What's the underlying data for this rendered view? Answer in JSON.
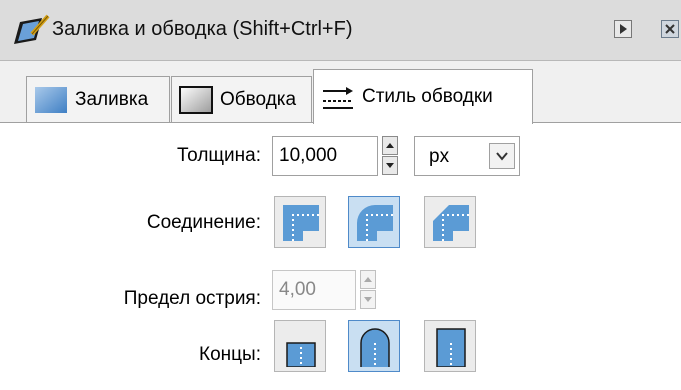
{
  "window": {
    "title": "Заливка и обводка (Shift+Ctrl+F)"
  },
  "tabs": [
    {
      "label": "Заливка",
      "icon": "fill-swatch-icon"
    },
    {
      "label": "Обводка",
      "icon": "stroke-paint-icon"
    },
    {
      "label": "Стиль обводки",
      "icon": "stroke-style-icon",
      "active": true
    }
  ],
  "stroke_style": {
    "width_label": "Толщина:",
    "width_value": "10,000",
    "unit": "px",
    "join_label": "Соединение:",
    "joins": [
      {
        "name": "miter",
        "selected": false
      },
      {
        "name": "round",
        "selected": true
      },
      {
        "name": "bevel",
        "selected": false
      }
    ],
    "miter_label": "Предел острия:",
    "miter_value": "4,00",
    "caps_label": "Концы:",
    "caps": [
      {
        "name": "butt",
        "selected": false
      },
      {
        "name": "round",
        "selected": true
      },
      {
        "name": "square",
        "selected": false
      }
    ]
  },
  "colors": {
    "selected_bg": "#c9dff2",
    "selected_border": "#4f8ac9",
    "shape_fill": "#5b9bd5"
  }
}
